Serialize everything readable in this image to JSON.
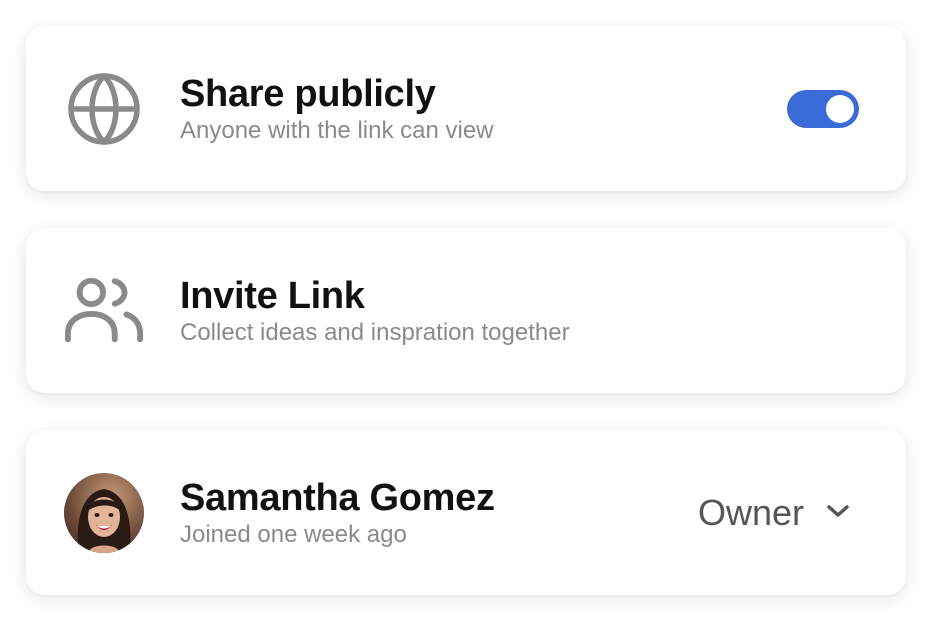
{
  "share": {
    "icon": "globe-icon",
    "title": "Share publicly",
    "subtitle": "Anyone with the link can view",
    "toggle_on": true,
    "toggle_color": "#3a6bd6"
  },
  "invite": {
    "icon": "users-icon",
    "title": "Invite Link",
    "subtitle": "Collect ideas and inspration together"
  },
  "member": {
    "name": "Samantha Gomez",
    "subtitle": "Joined one week ago",
    "role": "Owner",
    "dropdown_icon": "chevron-down-icon"
  },
  "colors": {
    "title": "#111111",
    "subtitle": "#8a8a8a",
    "icon": "#8a8a8a",
    "role": "#555555"
  }
}
